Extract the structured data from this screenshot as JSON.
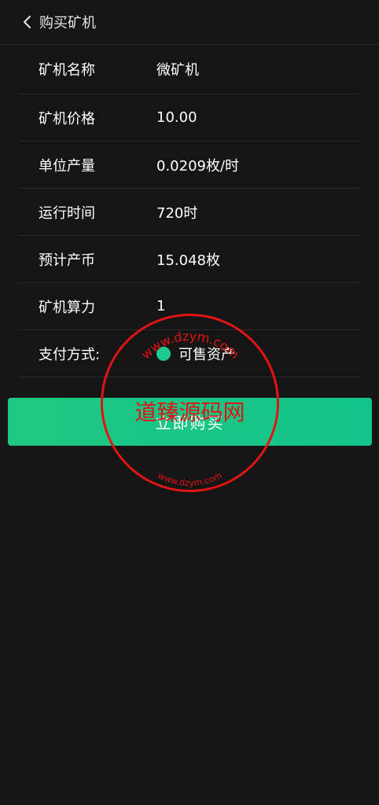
{
  "header": {
    "title": "购买矿机"
  },
  "info": {
    "rows": [
      {
        "label": "矿机名称",
        "value": "微矿机"
      },
      {
        "label": "矿机价格",
        "value": "10.00"
      },
      {
        "label": "单位产量",
        "value": "0.0209枚/时"
      },
      {
        "label": "运行时间",
        "value": "720时"
      },
      {
        "label": "预计产币",
        "value": "15.048枚"
      },
      {
        "label": "矿机算力",
        "value": "1"
      }
    ],
    "payment": {
      "label": "支付方式:",
      "option": "可售资产"
    }
  },
  "buy_button": {
    "label": "立即购买"
  },
  "watermark": {
    "text": "道臻源码网",
    "top_arc": "www.dzym.com",
    "bottom_arc": "www.dzym.com"
  },
  "colors": {
    "background": "#151515",
    "accent": "#1ec98d",
    "stamp": "#e01414"
  }
}
